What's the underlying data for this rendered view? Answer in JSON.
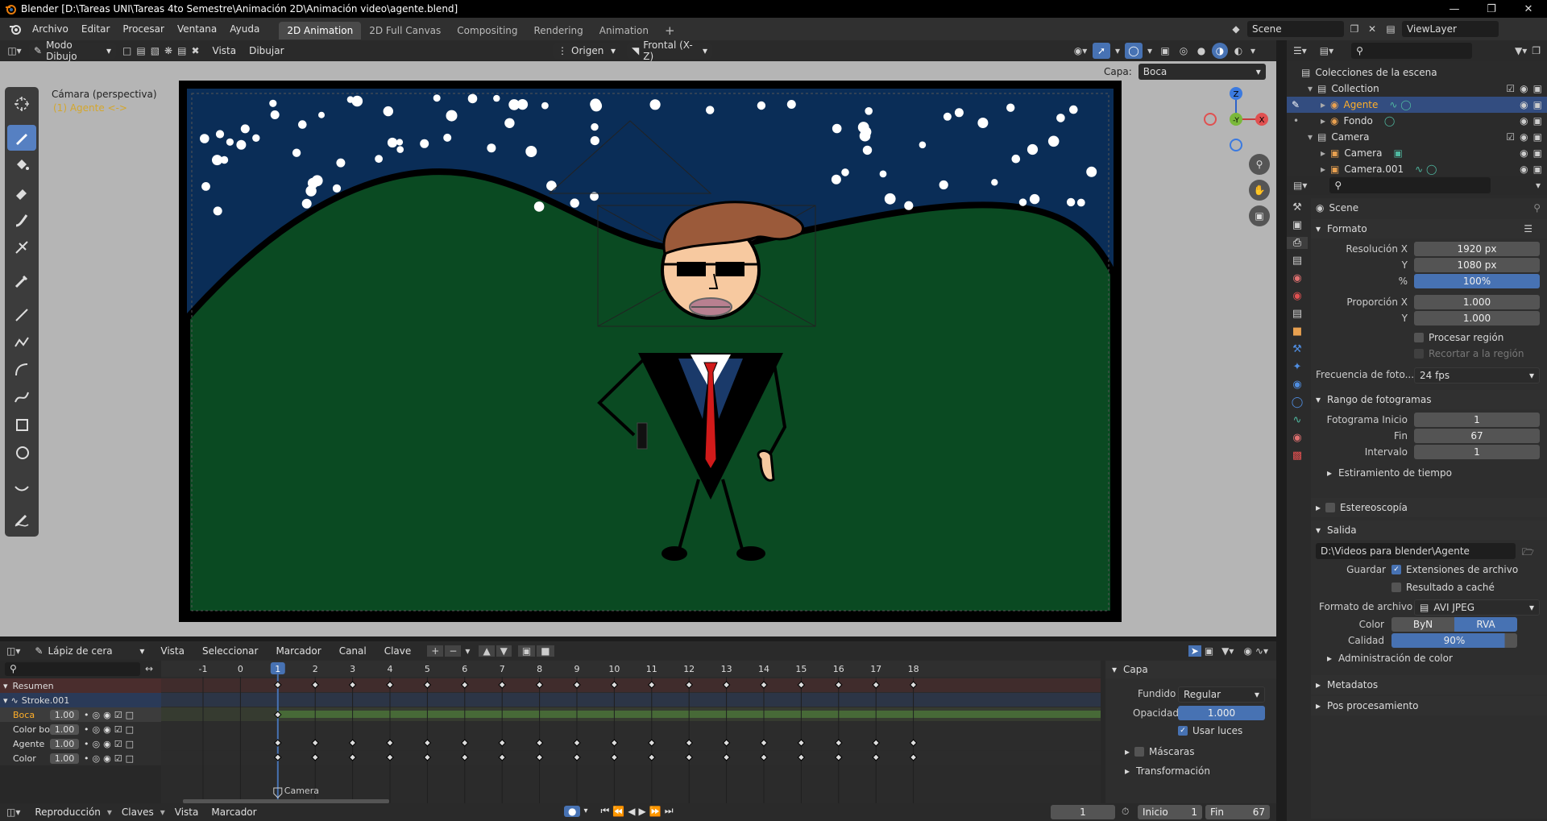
{
  "window": {
    "title": "Blender [D:\\Tareas UNI\\Tareas 4to Semestre\\Animación 2D\\Animación video\\agente.blend]"
  },
  "menus": [
    "Archivo",
    "Editar",
    "Procesar",
    "Ventana",
    "Ayuda"
  ],
  "workspace_tabs": [
    "2D Animation",
    "2D Full Canvas",
    "Compositing",
    "Rendering",
    "Animation"
  ],
  "scene_name": "Scene",
  "view_layer": "ViewLayer",
  "viewport_header": {
    "mode": "Modo Dibujo",
    "menu_vista": "Vista",
    "menu_dibujar": "Dibujar",
    "origin": "Origen",
    "orientation": "Frontal (X-Z)"
  },
  "layer_bar": {
    "label": "Capa:",
    "value": "Boca"
  },
  "viewport": {
    "camera_label": "Cámara (perspectiva)",
    "object_label": "(1) Agente <->",
    "colors": {
      "sky": "#0a2d57",
      "grass": "#0a4a22",
      "skin": "#f7c9a0",
      "hair": "#9b5a3a",
      "tie": "#d11a1a"
    }
  },
  "gizmo": {
    "z": "Z",
    "y": "-Y",
    "x": "X"
  },
  "outliner": {
    "root": "Colecciones de la escena",
    "items": [
      {
        "name": "Collection",
        "level": 0
      },
      {
        "name": "Agente",
        "level": 1,
        "selected": true
      },
      {
        "name": "Fondo",
        "level": 1
      },
      {
        "name": "Camera",
        "level": 0
      },
      {
        "name": "Camera",
        "level": 1
      },
      {
        "name": "Camera.001",
        "level": 1
      }
    ]
  },
  "properties": {
    "scene_title": "Scene",
    "formato": {
      "header": "Formato",
      "res_x_label": "Resolución X",
      "res_x": "1920 px",
      "res_y_label": "Y",
      "res_y": "1080 px",
      "pct_label": "%",
      "pct": "100%",
      "aspect_x_label": "Proporción X",
      "aspect_x": "1.000",
      "aspect_y_label": "Y",
      "aspect_y": "1.000",
      "region_label": "Procesar región",
      "crop_label": "Recortar a la región",
      "fps_label": "Frecuencia de foto...",
      "fps": "24 fps"
    },
    "rango": {
      "header": "Rango de fotogramas",
      "start_label": "Fotograma  Inicio",
      "start": "1",
      "end_label": "Fin",
      "end": "67",
      "step_label": "Intervalo",
      "step": "1",
      "stretch": "Estiramiento de tiempo"
    },
    "estereo": "Estereoscopía",
    "salida": {
      "header": "Salida",
      "path": "D:\\Videos para blender\\Agente",
      "guardar_label": "Guardar",
      "ext_label": "Extensiones de archivo",
      "cache_label": "Resultado a caché",
      "format_label": "Formato de archivo",
      "format": "AVI JPEG",
      "color_label": "Color",
      "color_bw": "ByN",
      "color_rgb": "RVA",
      "quality_label": "Calidad",
      "quality": "90%",
      "color_mgmt": "Administración de color"
    },
    "metadatos": "Metadatos",
    "post": "Pos procesamiento"
  },
  "timeline": {
    "header": {
      "tool": "Lápiz de cera",
      "menus": [
        "Vista",
        "Seleccionar",
        "Marcador",
        "Canal",
        "Clave"
      ]
    },
    "channels": [
      {
        "name": "Resumen"
      },
      {
        "name": "Stroke.001"
      },
      {
        "name": "Boca",
        "value": "1.00"
      },
      {
        "name": "Color boca",
        "value": "1.00"
      },
      {
        "name": "Agente",
        "value": "1.00"
      },
      {
        "name": "Color",
        "value": "1.00"
      }
    ],
    "frames": [
      "-1",
      "0",
      "1",
      "2",
      "3",
      "4",
      "5",
      "6",
      "7",
      "8",
      "9",
      "10",
      "11",
      "12",
      "13",
      "14",
      "15",
      "16",
      "17",
      "18"
    ],
    "current_frame": "1",
    "marker": "Camera",
    "side_panel": {
      "header": "Capa",
      "blend_label": "Fundido",
      "blend": "Regular",
      "opacity_label": "Opacidad",
      "opacity": "1.000",
      "lights_label": "Usar luces",
      "masks": "Máscaras",
      "transform": "Transformación"
    }
  },
  "status": {
    "menus": [
      "Reproducción",
      "Claves",
      "Vista",
      "Marcador"
    ],
    "frame": "1",
    "start_label": "Inicio",
    "start": "1",
    "end_label": "Fin",
    "end": "67"
  }
}
